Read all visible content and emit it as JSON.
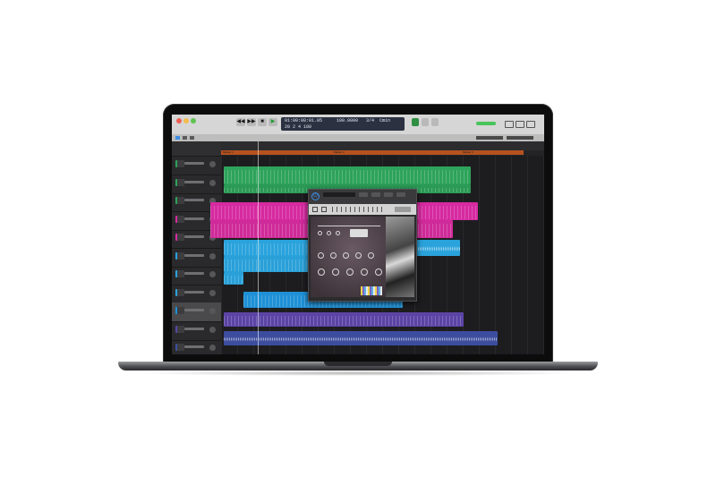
{
  "colors": {
    "bezel": "#0c0c0d",
    "screen": "#1f1f21",
    "green_region": "#2ea35b",
    "magenta_region": "#d62aa0",
    "cyan_region": "#2aa3dc",
    "blue_region": "#1e90d6",
    "purple_region": "#5b44a5",
    "audio_region": "#3c4d9e",
    "marker": "#b5521f",
    "accent": "#3c8de6"
  },
  "app": {
    "name": "Logic Pro"
  },
  "transport": {
    "time": "01:00:08:01.05",
    "position": "20 2 4 180",
    "tempo": "100.0000",
    "signature": "3/4",
    "key": "Cmin"
  },
  "markers": [
    {
      "label": "Marker 1"
    },
    {
      "label": "Marker 2"
    },
    {
      "label": "Marker 3"
    }
  ],
  "plugin": {
    "title": "Kontakt",
    "power_icon": "power-icon",
    "brand": "Kontakt"
  },
  "tracks": [
    {
      "name": "",
      "icon": "instrument-icon",
      "color": "#2ea35b"
    },
    {
      "name": "",
      "icon": "instrument-icon",
      "color": "#2ea35b"
    },
    {
      "name": "",
      "icon": "instrument-icon",
      "color": "#2ea35b"
    },
    {
      "name": "",
      "icon": "instrument-icon",
      "color": "#d62aa0"
    },
    {
      "name": "",
      "icon": "instrument-icon",
      "color": "#d62aa0"
    },
    {
      "name": "",
      "icon": "instrument-icon",
      "color": "#2aa3dc"
    },
    {
      "name": "",
      "icon": "instrument-icon",
      "color": "#2aa3dc"
    },
    {
      "name": "",
      "icon": "instrument-icon",
      "color": "#2aa3dc"
    },
    {
      "name": "",
      "icon": "instrument-icon",
      "color": "#1e90d6"
    },
    {
      "name": "",
      "icon": "instrument-icon",
      "color": "#5b44a5"
    },
    {
      "name": "",
      "icon": "audio-icon",
      "color": "#3c4d9e"
    }
  ]
}
